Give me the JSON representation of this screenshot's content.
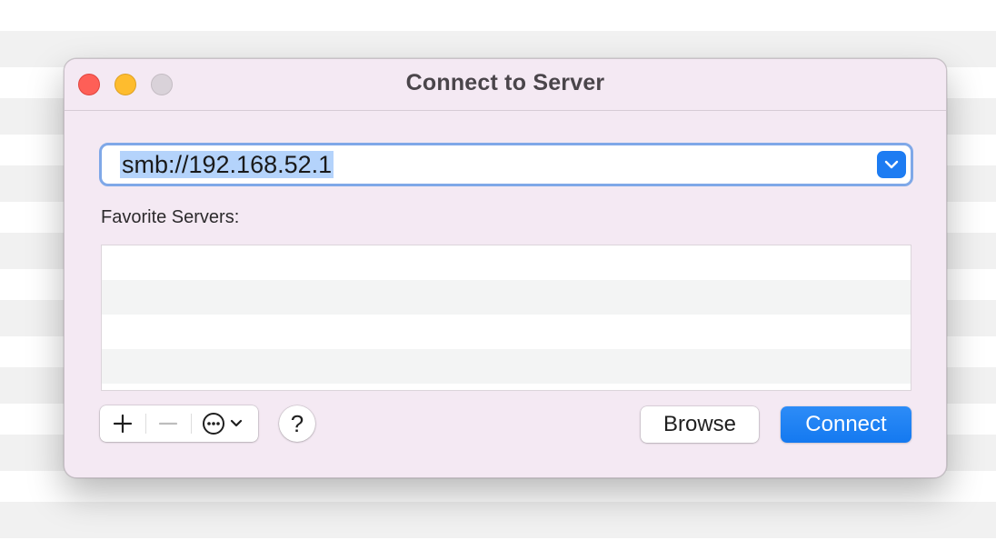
{
  "window": {
    "title": "Connect to Server"
  },
  "address": {
    "value": "smb://192.168.52.1",
    "dropdown_icon": "chevron-down-icon"
  },
  "favorites": {
    "label": "Favorite Servers:",
    "items": []
  },
  "toolbar": {
    "add_icon": "plus-icon",
    "remove_icon": "minus-icon",
    "more_icon": "ellipsis-circle-icon",
    "help_label": "?"
  },
  "buttons": {
    "browse": "Browse",
    "connect": "Connect"
  },
  "colors": {
    "accent": "#1479f0",
    "window_bg": "#f4e9f3",
    "close": "#fe5f57",
    "minimize": "#febc2e",
    "zoom_disabled": "#d9d2d9"
  }
}
